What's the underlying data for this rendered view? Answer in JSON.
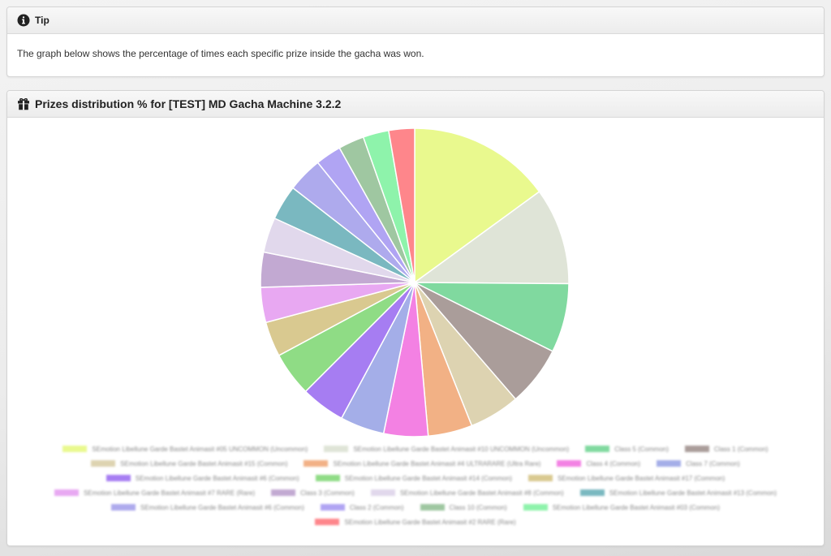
{
  "tip": {
    "title": "Tip",
    "text": "The graph below shows the percentage of times each specific prize inside the gacha was won."
  },
  "chart_panel": {
    "title": "Prizes distribution % for [TEST] MD Gacha Machine 3.2.2"
  },
  "icons": {
    "tip": "info-circle-icon",
    "chart": "gift-icon"
  },
  "chart_data": {
    "type": "pie",
    "title": "",
    "legend_position": "bottom",
    "series": [
      {
        "name": "SEmotion Libellune Garde Bastet Animasit #05 UNCOMMON (Uncommon)",
        "value": 15.5,
        "color": "#e9f98e"
      },
      {
        "name": "SEmotion Libellune Garde Bastet Animasit #10 UNCOMMON (Uncommon)",
        "value": 10.5,
        "color": "#dfe4d7"
      },
      {
        "name": "Class 5 (Common)",
        "value": 7.5,
        "color": "#80d99f"
      },
      {
        "name": "Class 1 (Common)",
        "value": 6.5,
        "color": "#aa9d9a"
      },
      {
        "name": "SEmotion Libellune Garde Bastet Animasit #15 (Common)",
        "value": 5.5,
        "color": "#ddd3b1"
      },
      {
        "name": "SEmotion Libellune Garde Bastet Animasit #4 ULTRARARE (Ultra Rare)",
        "value": 4.8,
        "color": "#f2b185"
      },
      {
        "name": "Class 4 (Common)",
        "value": 4.8,
        "color": "#f381e3"
      },
      {
        "name": "Class 7 (Common)",
        "value": 4.8,
        "color": "#a4aee8"
      },
      {
        "name": "SEmotion Libellune Garde Bastet Animasit #6 (Common)",
        "value": 4.8,
        "color": "#a67df2"
      },
      {
        "name": "SEmotion Libellune Garde Bastet Animasit #14 (Common)",
        "value": 4.8,
        "color": "#8fdc85"
      },
      {
        "name": "SEmotion Libellune Garde Bastet Animasit #17 (Common)",
        "value": 3.8,
        "color": "#d9c990"
      },
      {
        "name": "SEmotion Libellune Garde Bastet Animasit #7 RARE (Rare)",
        "value": 3.8,
        "color": "#e8a8f2"
      },
      {
        "name": "Class 3 (Common)",
        "value": 3.8,
        "color": "#c2a9d2"
      },
      {
        "name": "SEmotion Libellune Garde Bastet Animasit #8 (Common)",
        "value": 3.8,
        "color": "#e1d8ec"
      },
      {
        "name": "SEmotion Libellune Garde Bastet Animasit #13 (Common)",
        "value": 3.8,
        "color": "#7ab8c0"
      },
      {
        "name": "SEmotion Libellune Garde Bastet Animasit #6 (Common)",
        "value": 3.8,
        "color": "#aeaaed"
      },
      {
        "name": "Class 2 (Common)",
        "value": 2.8,
        "color": "#b0a4f3"
      },
      {
        "name": "Class 10 (Common)",
        "value": 2.8,
        "color": "#9fc7a1"
      },
      {
        "name": "SEmotion Libellune Garde Bastet Animasit #03 (Common)",
        "value": 2.8,
        "color": "#8ef3ab"
      },
      {
        "name": "SEmotion Libellune Garde Bastet Animasit #2 RARE (Rare)",
        "value": 2.8,
        "color": "#fe868b"
      }
    ]
  }
}
